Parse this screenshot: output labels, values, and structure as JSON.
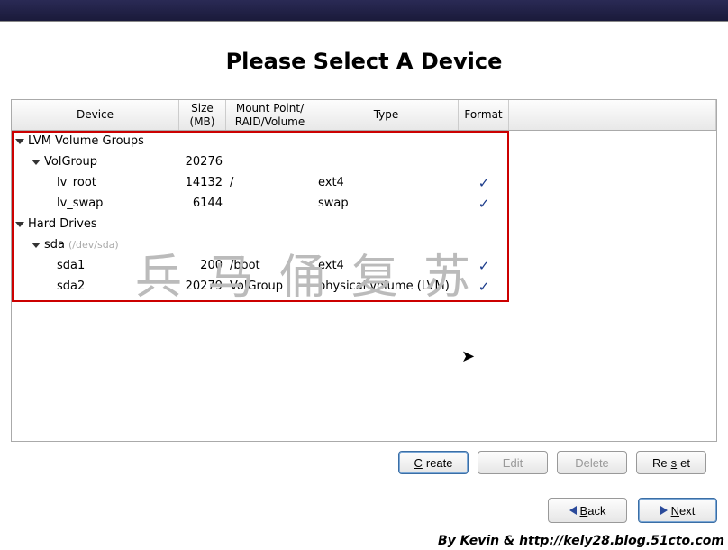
{
  "title": "Please Select A Device",
  "columns": {
    "device": "Device",
    "size": "Size\n(MB)",
    "mount": "Mount Point/\nRAID/Volume",
    "type": "Type",
    "format": "Format"
  },
  "rows": [
    {
      "indent": 0,
      "expander": true,
      "device": "LVM Volume Groups",
      "size": "",
      "mount": "",
      "type": "",
      "format": ""
    },
    {
      "indent": 1,
      "expander": true,
      "device": "VolGroup",
      "size": "20276",
      "mount": "",
      "type": "",
      "format": ""
    },
    {
      "indent": 2,
      "expander": false,
      "device": "lv_root",
      "size": "14132",
      "mount": "/",
      "type": "ext4",
      "format": "✓"
    },
    {
      "indent": 2,
      "expander": false,
      "device": "lv_swap",
      "size": "6144",
      "mount": "",
      "type": "swap",
      "format": "✓"
    },
    {
      "indent": 0,
      "expander": true,
      "device": "Hard Drives",
      "size": "",
      "mount": "",
      "type": "",
      "format": ""
    },
    {
      "indent": 1,
      "expander": true,
      "device": "sda",
      "dim": "(/dev/sda)",
      "size": "",
      "mount": "",
      "type": "",
      "format": ""
    },
    {
      "indent": 2,
      "expander": false,
      "device": "sda1",
      "size": "200",
      "mount": "/boot",
      "type": "ext4",
      "format": "✓"
    },
    {
      "indent": 2,
      "expander": false,
      "device": "sda2",
      "size": "20279",
      "mount": "VolGroup",
      "type": "physical volume (LVM)",
      "format": "✓"
    }
  ],
  "buttons": {
    "create": "Create",
    "edit": "Edit",
    "delete": "Delete",
    "reset": "Reset",
    "back": "Back",
    "next": "Next"
  },
  "watermark": "兵马俑复苏",
  "credit": "By Kevin & http://kely28.blog.51cto.com"
}
